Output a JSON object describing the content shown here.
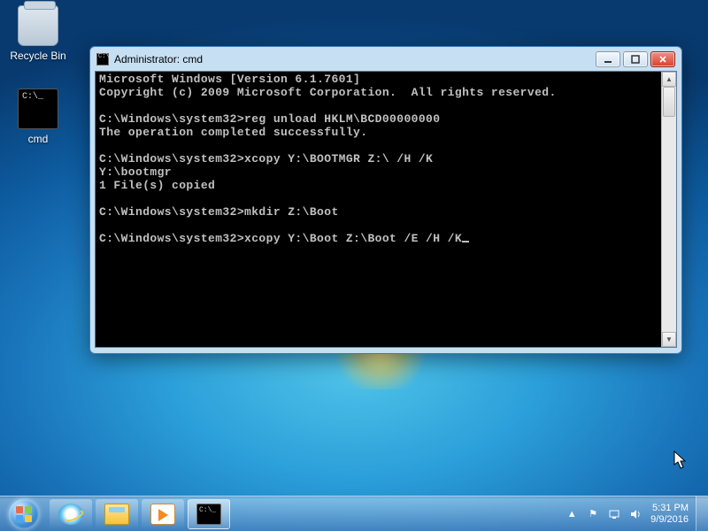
{
  "desktop_icons": {
    "recycle_bin": "Recycle Bin",
    "cmd": "cmd"
  },
  "window": {
    "title": "Administrator: cmd",
    "terminal": {
      "line1": "Microsoft Windows [Version 6.1.7601]",
      "line2": "Copyright (c) 2009 Microsoft Corporation.  All rights reserved.",
      "prompt": "C:\\Windows\\system32>",
      "cmd1": "reg unload HKLM\\BCD00000000",
      "resp1": "The operation completed successfully.",
      "cmd2": "xcopy Y:\\BOOTMGR Z:\\ /H /K",
      "resp2a": "Y:\\bootmgr",
      "resp2b": "1 File(s) copied",
      "cmd3": "mkdir Z:\\Boot",
      "cmd4": "xcopy Y:\\Boot Z:\\Boot /E /H /K"
    }
  },
  "systray": {
    "time": "5:31 PM",
    "date": "9/9/2016"
  }
}
